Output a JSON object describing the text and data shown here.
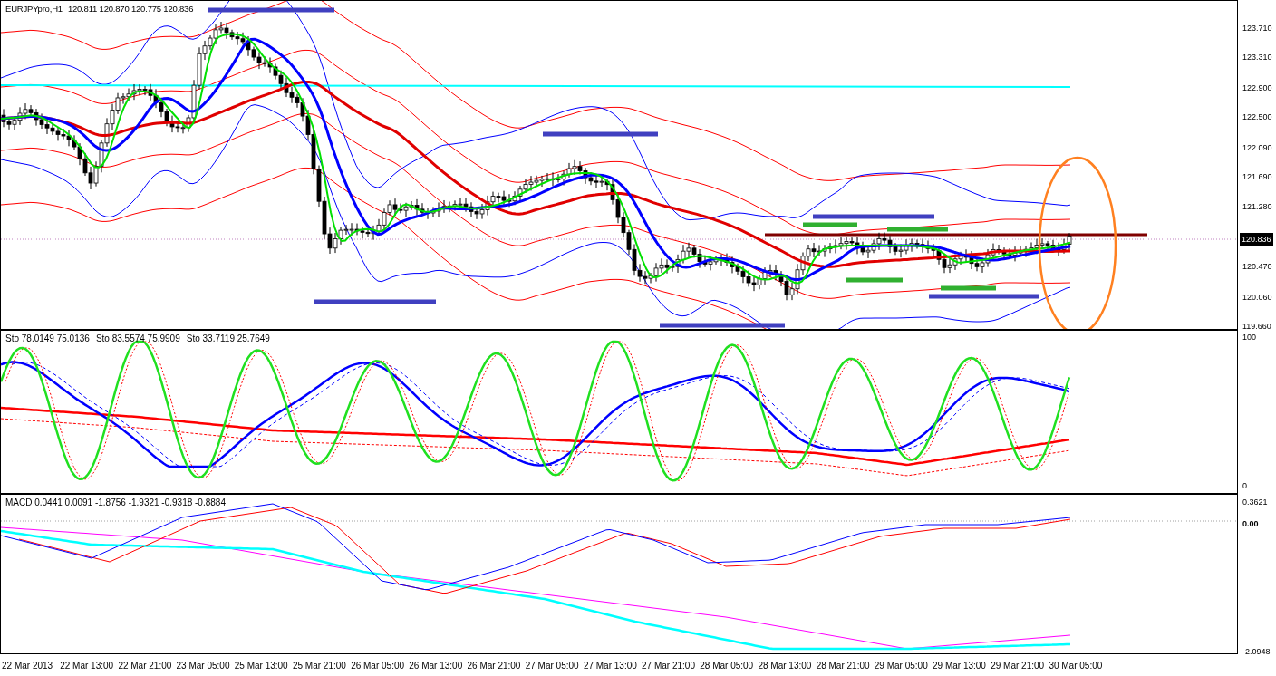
{
  "main_panel": {
    "symbol": "EURJPYpro,H1",
    "quote": "120.811 120.870 120.775 120.836",
    "price_axis": [
      {
        "label": "123.710",
        "kind": "tick"
      },
      {
        "label": "123.310",
        "kind": "tick"
      },
      {
        "label": "122.900",
        "kind": "tick"
      },
      {
        "label": "122.500",
        "kind": "tick"
      },
      {
        "label": "122.090",
        "kind": "tick"
      },
      {
        "label": "121.690",
        "kind": "tick"
      },
      {
        "label": "121.280",
        "kind": "tick"
      },
      {
        "label": "120.836",
        "kind": "current"
      },
      {
        "label": "120.470",
        "kind": "tick"
      },
      {
        "label": "120.060",
        "kind": "tick"
      },
      {
        "label": "119.660",
        "kind": "tick"
      }
    ]
  },
  "stochastic_panel": {
    "legend": [
      "Sto 78.0149 75.0136",
      "Sto 83.5574 75.9909",
      "Sto 33.7119 25.7649"
    ],
    "axis": [
      "100",
      "0"
    ]
  },
  "macd_panel": {
    "legend": "MACD 0.0441 0.0091 -1.8756 -1.9321 -0.9318 -0.8884",
    "axis": [
      {
        "label": "0.3621",
        "kind": "tick"
      },
      {
        "label": "0.00",
        "kind": "zero"
      },
      {
        "label": "-2.0948",
        "kind": "tick"
      }
    ]
  },
  "time_axis": [
    "22 Mar 2013",
    "22 Mar 13:00",
    "22 Mar 21:00",
    "23 Mar 05:00",
    "25 Mar 13:00",
    "25 Mar 21:00",
    "26 Mar 05:00",
    "26 Mar 13:00",
    "26 Mar 21:00",
    "27 Mar 05:00",
    "27 Mar 13:00",
    "27 Mar 21:00",
    "28 Mar 05:00",
    "28 Mar 13:00",
    "28 Mar 21:00",
    "29 Mar 05:00",
    "29 Mar 13:00",
    "29 Mar 21:00",
    "30 Mar 05:00"
  ]
}
